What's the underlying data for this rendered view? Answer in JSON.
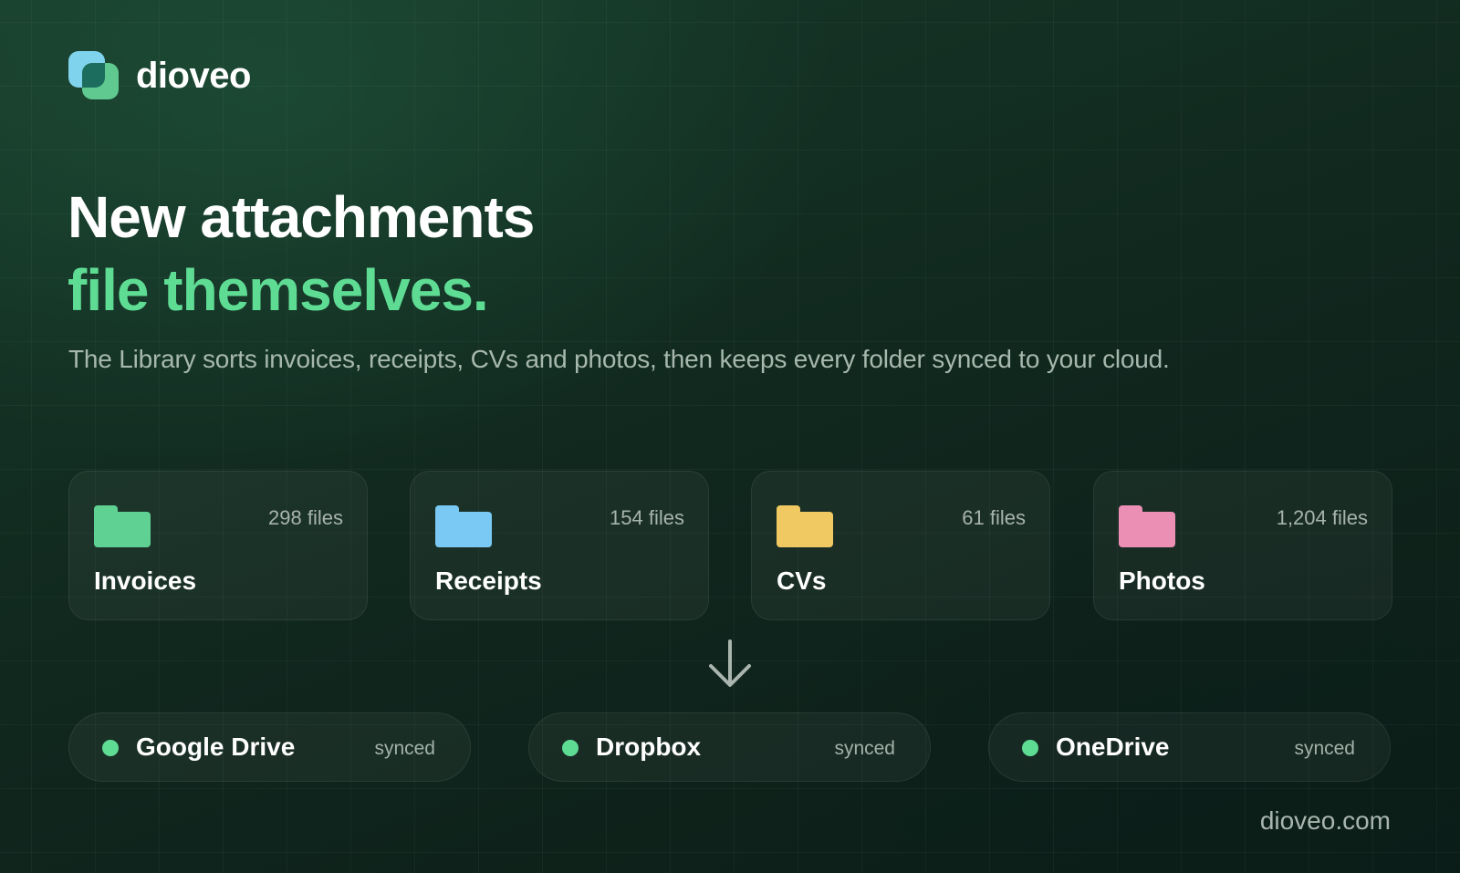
{
  "brand": {
    "name": "dioveo",
    "icon": "dioveo-logo-icon"
  },
  "hero": {
    "line1": "New attachments",
    "line2": "file themselves.",
    "subtitle": "The Library sorts invoices, receipts, CVs and photos, then keeps every folder synced to your cloud."
  },
  "folders": [
    {
      "name": "Invoices",
      "count": "298 files",
      "color": "#5fd193",
      "icon": "folder-icon"
    },
    {
      "name": "Receipts",
      "count": "154 files",
      "color": "#79c9f4",
      "icon": "folder-icon"
    },
    {
      "name": "CVs",
      "count": "61 files",
      "color": "#f0c962",
      "icon": "folder-icon"
    },
    {
      "name": "Photos",
      "count": "1,204 files",
      "color": "#ec8fb4",
      "icon": "folder-icon"
    }
  ],
  "flow": {
    "icon": "arrow-down-icon"
  },
  "clouds": [
    {
      "name": "Google Drive",
      "status": "synced",
      "dot_color": "#5fdc94"
    },
    {
      "name": "Dropbox",
      "status": "synced",
      "dot_color": "#5fdc94"
    },
    {
      "name": "OneDrive",
      "status": "synced",
      "dot_color": "#5fdc94"
    }
  ],
  "footer": {
    "url": "dioveo.com"
  },
  "colors": {
    "accent": "#5fdc94",
    "background": "#11291f"
  }
}
